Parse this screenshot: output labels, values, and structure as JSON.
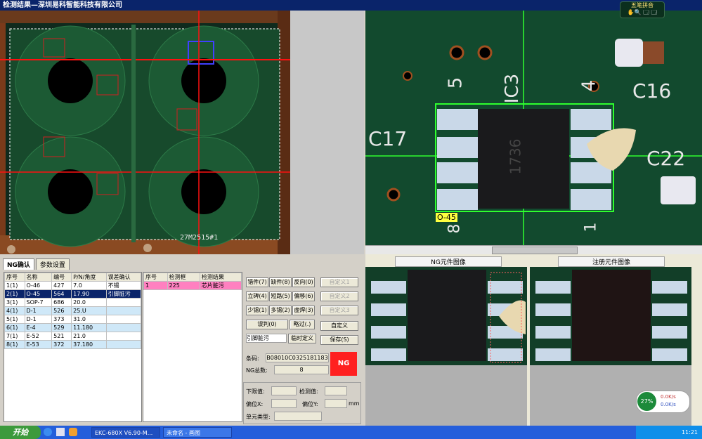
{
  "window": {
    "title": "检测结果—深圳易科智能科技有限公司"
  },
  "toolbar_badge": {
    "text": "五笔拼音",
    "icons": "✋🔍 🗔 🗔"
  },
  "overview": {
    "board_label": "27M2515#1"
  },
  "zoom": {
    "labels": [
      "5",
      "IC3",
      "4",
      "C16",
      "C17",
      "C22",
      "8",
      "1"
    ],
    "part_tag": "O-45",
    "chip_text": "1736"
  },
  "tabs": [
    "NG确认",
    "参数设置"
  ],
  "ng_table": {
    "headers": [
      "序号",
      "名称",
      "编号",
      "P/N/角度",
      "误差确认"
    ],
    "rows": [
      [
        "1(1)",
        "O-46",
        "427",
        "7.0",
        "不锡"
      ],
      [
        "2(1)",
        "O-45",
        "564",
        "17.90",
        "引脚脏污"
      ],
      [
        "3(1)",
        "SOP-7",
        "686",
        "20.0",
        ""
      ],
      [
        "4(1)",
        "D-1",
        "526",
        "25.U",
        ""
      ],
      [
        "5(1)",
        "D-1",
        "373",
        "31.0",
        ""
      ],
      [
        "6(1)",
        "E-4",
        "529",
        "11.180",
        ""
      ],
      [
        "7(1)",
        "E-52",
        "521",
        "21.0",
        ""
      ],
      [
        "8(1)",
        "E-53",
        "372",
        "37.180",
        ""
      ]
    ]
  },
  "detail_table": {
    "headers": [
      "序号",
      "检测框",
      "检测结果"
    ],
    "rows": [
      [
        "1",
        "225",
        "芯片脏污"
      ]
    ]
  },
  "defect_buttons": [
    [
      "错件(7)",
      "缺件(8)",
      "反向(0)"
    ],
    [
      "立碑(4)",
      "短路(5)",
      "偏移(6)"
    ],
    [
      "少锡(1)",
      "多锡(2)",
      "虚焊(3)"
    ]
  ],
  "custom_buttons": [
    "自定义1",
    "自定义2",
    "自定义3"
  ],
  "controls": {
    "retest": "误判(0)",
    "skip": "略过(.)",
    "custom_define": "自定义",
    "save": "保存(S)",
    "temp_define": "临时定义",
    "input_value": "引脚脏污"
  },
  "result": {
    "barcode_label": "条码:",
    "barcode": "B08010C0325181183",
    "ng_total_label": "NG总数:",
    "ng_total": "8",
    "status": "NG"
  },
  "measure": {
    "lower_label": "下限值:",
    "detect_label": "检测值:",
    "offset_x_label": "偏位X:",
    "offset_y_label": "偏位Y:",
    "unit": "mm",
    "element_type_label": "单元类型:"
  },
  "compare": {
    "ng_title": "NG元件图像",
    "ref_title": "注册元件图像"
  },
  "speed_widget": {
    "percent": "27%",
    "up": "0.0K/s",
    "down": "0.0K/s"
  },
  "taskbar": {
    "start": "开始",
    "tasks": [
      "EKC-680X V6.90-M...",
      "未命名 - 画图"
    ],
    "clock": "11:21"
  },
  "colors": {
    "title_bg": "#0a246a",
    "ng_red": "#ff2020",
    "highlight_pink": "#ff80c0",
    "select_blue": "#0a246a"
  }
}
